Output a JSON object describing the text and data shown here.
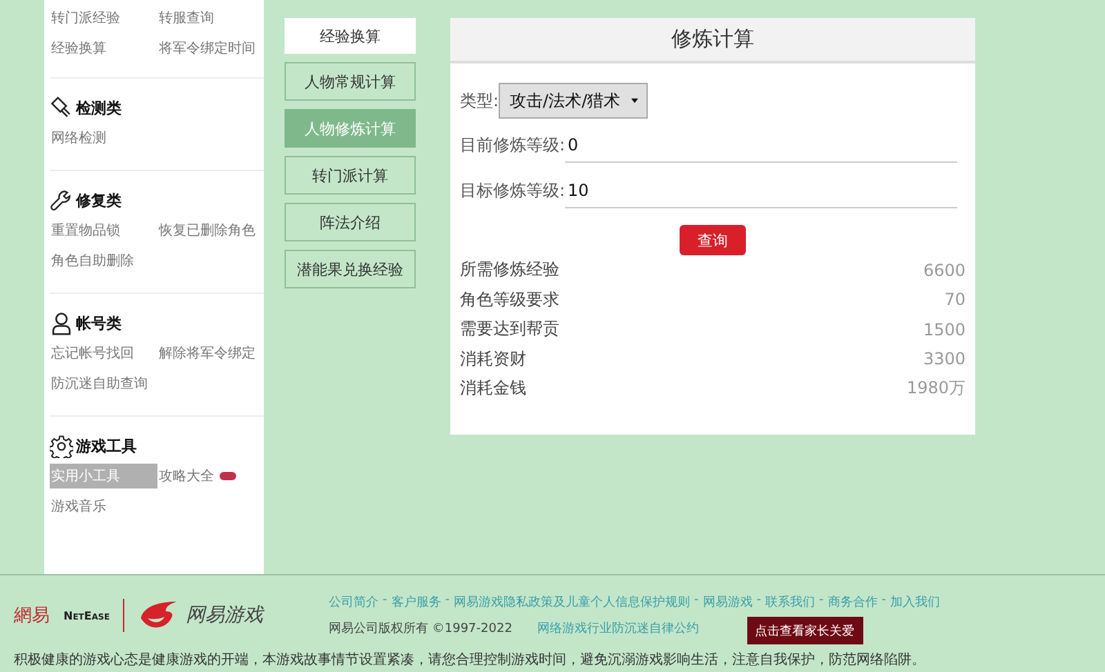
{
  "sidebar": {
    "sections": [
      {
        "items": [
          {
            "label": "转门派经验",
            "selected": false
          },
          {
            "label": "转服查询",
            "selected": false
          },
          {
            "label": "经验换算",
            "selected": false
          },
          {
            "label": "将军令绑定时间",
            "selected": false
          }
        ]
      },
      {
        "title": "检测类",
        "items": [
          {
            "label": "网络检测",
            "selected": false
          }
        ]
      },
      {
        "title": "修复类",
        "items": [
          {
            "label": "重置物品锁",
            "selected": false
          },
          {
            "label": "恢复已删除角色",
            "selected": false
          },
          {
            "label": "角色自助删除",
            "selected": false
          }
        ]
      },
      {
        "title": "帐号类",
        "items": [
          {
            "label": "忘记帐号找回",
            "selected": false
          },
          {
            "label": "解除将军令绑定",
            "selected": false
          },
          {
            "label": "防沉迷自助查询",
            "selected": false
          }
        ]
      },
      {
        "title": "游戏工具",
        "items": [
          {
            "label": "实用小工具",
            "selected": true
          },
          {
            "label": "攻略大全",
            "selected": false,
            "tag": true
          },
          {
            "label": "游戏音乐",
            "selected": false
          }
        ]
      }
    ]
  },
  "tabs": [
    {
      "label": "经验换算",
      "kind": "heading"
    },
    {
      "label": "人物常规计算",
      "kind": "tab",
      "selected": false
    },
    {
      "label": "人物修炼计算",
      "kind": "tab",
      "selected": true
    },
    {
      "label": "转门派计算",
      "kind": "tab",
      "selected": false
    },
    {
      "label": "阵法介绍",
      "kind": "tab",
      "selected": false
    },
    {
      "label": "潜能果兑换经验",
      "kind": "tab",
      "selected": false
    }
  ],
  "calculator": {
    "title": "修炼计算",
    "type_label": "类型:",
    "type_value": "攻击/法术/猎术",
    "fields": [
      {
        "label": "目前修炼等级:",
        "value": "0"
      },
      {
        "label": "目标修炼等级:",
        "value": "10"
      }
    ],
    "button": "查询",
    "results": [
      {
        "label": "所需修炼经验",
        "value": "6600"
      },
      {
        "label": "角色等级要求",
        "value": "70"
      },
      {
        "label": "需要达到帮贡",
        "value": "1500"
      },
      {
        "label": "消耗资财",
        "value": "3300"
      },
      {
        "label": "消耗金钱",
        "value": "1980万"
      }
    ]
  },
  "footer": {
    "logo_cn": "網易",
    "logo_en": "NetEase",
    "games_logo": "网易游戏",
    "links": [
      "公司简介",
      "客户服务",
      "网易游戏隐私政策及儿童个人信息保护规则",
      "网易游戏",
      "联系我们",
      "商务合作",
      "加入我们"
    ],
    "separator": "-",
    "copyright": "网易公司版权所有 ©1997-2022",
    "self_discipline": "网络游戏行业防沉迷自律公约",
    "parent_button": "点击查看家长关爱",
    "notice": "积极健康的游戏心态是健康游戏的开端，本游戏故事情节设置紧凑，请您合理控制游戏时间，避免沉溺游戏影响生活，注意自我保护，防范网络陷阱。"
  }
}
